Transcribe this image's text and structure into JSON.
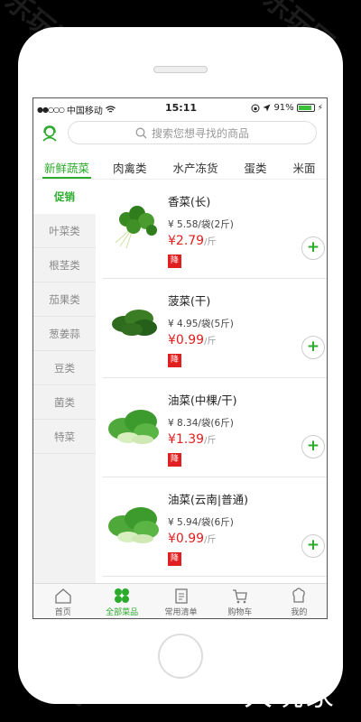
{
  "status": {
    "carrier": "中国移动",
    "time": "15:11",
    "battery": "91%",
    "battery_level": 0.91
  },
  "search": {
    "placeholder": "搜索您想寻找的商品"
  },
  "categories": [
    "新鲜蔬菜",
    "肉禽类",
    "水产冻货",
    "蛋类",
    "米面"
  ],
  "subnav": [
    "促销",
    "叶菜类",
    "根茎类",
    "茄果类",
    "葱姜蒜",
    "豆类",
    "菌类",
    "特菜"
  ],
  "products": [
    {
      "name": "香菜(长)",
      "spec": "¥ 5.58/袋(2斤)",
      "price": "¥2.79",
      "unit": "/斤",
      "badge": "降",
      "add": "+"
    },
    {
      "name": "菠菜(干)",
      "spec": "¥ 4.95/袋(5斤)",
      "price": "¥0.99",
      "unit": "/斤",
      "badge": "降",
      "add": "+"
    },
    {
      "name": "油菜(中棵/干)",
      "spec": "¥ 8.34/袋(6斤)",
      "price": "¥1.39",
      "unit": "/斤",
      "badge": "降",
      "add": "+"
    },
    {
      "name": "油菜(云南|普通)",
      "spec": "¥ 5.94/袋(6斤)",
      "price": "¥0.99",
      "unit": "/斤",
      "badge": "降",
      "add": "+"
    }
  ],
  "tabbar": [
    "首页",
    "全部菜品",
    "常用清单",
    "购物车",
    "我的"
  ],
  "watermark": {
    "text": "乐玩网",
    "brand": "大玩家"
  },
  "colors": {
    "accent": "#2bab2b",
    "price": "#e02020"
  }
}
